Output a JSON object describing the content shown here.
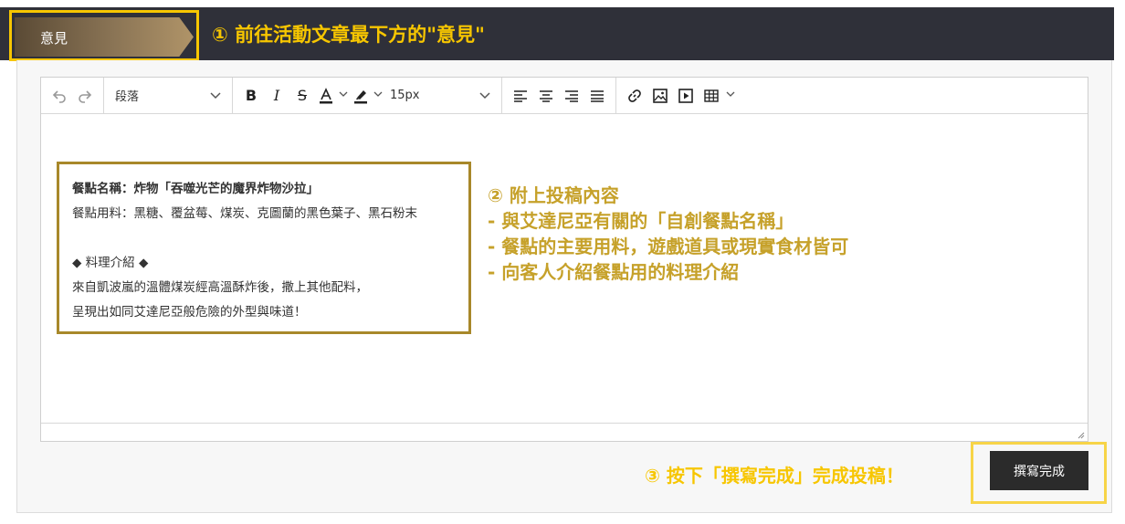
{
  "header": {
    "tab_label": "意見",
    "step1": "① 前往活動文章最下方的\"意見\""
  },
  "toolbar": {
    "undo_icon": "undo-icon",
    "redo_icon": "redo-icon",
    "paragraph_select": "段落",
    "font_size_select": "15px"
  },
  "post": {
    "line1": "餐點名稱：炸物「吞噬光芒的魔界炸物沙拉」",
    "line2": "餐點用料：黑糖、覆盆莓、煤炭、克圖蘭的黑色葉子、黑石粉末",
    "line3": "◆ 料理介紹 ◆",
    "line4": "來自凱波嵐的溫體煤炭經高溫酥炸後，撒上其他配料，",
    "line5": "呈現出如同艾達尼亞般危險的外型與味道！"
  },
  "step2": {
    "title": "② 附上投稿內容",
    "item1": "- 與艾達尼亞有關的「自創餐點名稱」",
    "item2": "- 餐點的主要用料，遊戲道具或現實食材皆可",
    "item3": "- 向客人介紹餐點用的料理介紹"
  },
  "step3": {
    "text": "③ 按下「撰寫完成」完成投稿！",
    "button_label": "撰寫完成"
  },
  "colors": {
    "highlight_yellow": "#f7c600",
    "gold_text": "#c6a12a",
    "post_border": "#a8882a",
    "header_bg": "#2f3039",
    "button_bg": "#2b2b2b"
  }
}
